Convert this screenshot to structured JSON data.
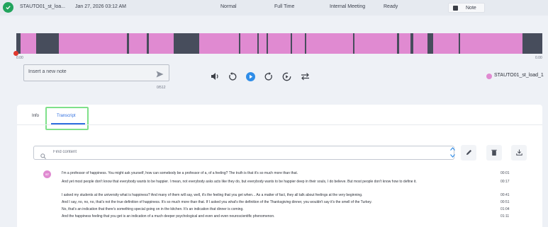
{
  "header": {
    "recording_name": "STAUTO01_st_loa...",
    "datetime": "Jan 27, 2026 03:12 AM",
    "priority": "Normal",
    "shift": "Full Time",
    "category": "Internal Meeting",
    "status": "Ready",
    "note_label": "Note",
    "status_icon": "check-circle-icon"
  },
  "waveform": {
    "start_time": "0.00",
    "end_time": "0.00",
    "colors": {
      "background": "#474d5c",
      "speech": "#e08ad1"
    }
  },
  "note_input": {
    "placeholder": "Insert a new note",
    "counter": "0/512"
  },
  "controls": [
    "volume-icon",
    "rewind-icon",
    "play-icon",
    "forward-icon",
    "speed-icon",
    "loop-icon"
  ],
  "speaker": {
    "name": "STAUTO01_st_load_1",
    "color": "#e08ad1"
  },
  "tabs": [
    {
      "label": "Info"
    },
    {
      "label": "Transcript",
      "active": true
    }
  ],
  "search": {
    "placeholder": "Find content"
  },
  "transcript": {
    "avatar": "ST",
    "lines": [
      {
        "text": "I'm a professor of happiness. You might ask yourself, how can somebody be a professor of a, of a feeling? The truth is that it's so much more than that.",
        "time": "00:01"
      },
      {
        "text": "And yet most people don't know that everybody wants to be happier. I mean, not everybody asks acts like they do, but everybody wants to be happier deep in their souls, I do believe. But most people don't know how to define it.",
        "time": "00:17"
      },
      {
        "text": "I asked my students at the university what is happiness? And many of them will say, well, it's the feeling that you get when... As a matter of fact, they all talk about feelings at the very beginning.",
        "time": "00:41"
      },
      {
        "text": "And I say, no, no, no, that's not the true definition of happiness. It's so much more than that. If I asked you what's the definition of the Thanksgiving dinner, you wouldn't say it's the smell of the Turkey.",
        "time": "00:51"
      },
      {
        "text": "No, that's an indication that there's something special going on in the kitchen. It's an indication that dinner is coming.",
        "time": "01:04"
      },
      {
        "text": "And the happiness feeling that you get is an indication of a much deeper psychological and even and even neuroscientific phenomenon.",
        "time": "01:11"
      }
    ]
  }
}
